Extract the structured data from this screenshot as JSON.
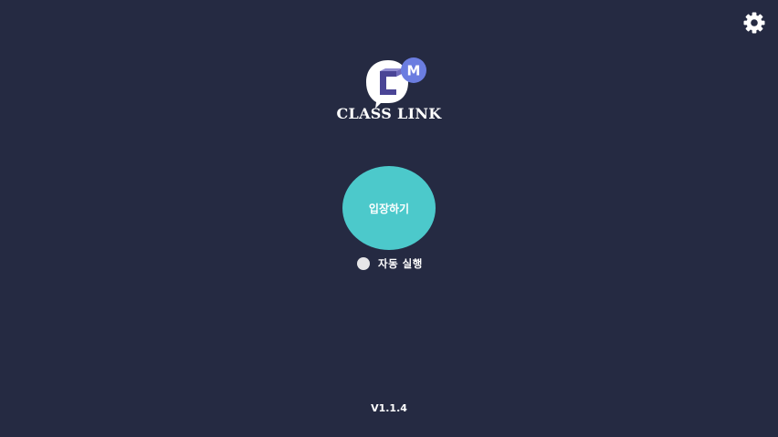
{
  "app": {
    "brand_name": "CLASS LINK",
    "logo_badge": "M",
    "enter_label": "입장하기",
    "autorun_label": "자동 실행",
    "autorun_checked": false,
    "version": "V1.1.4"
  },
  "icons": {
    "settings": "gear-icon",
    "logo": "class-link-logo-icon",
    "autorun": "radio-icon"
  },
  "colors": {
    "background": "#252a42",
    "accent": "#4cc9cb",
    "badge": "#6b7de0",
    "logo_c": "#4a4596",
    "text": "#ffffff"
  }
}
